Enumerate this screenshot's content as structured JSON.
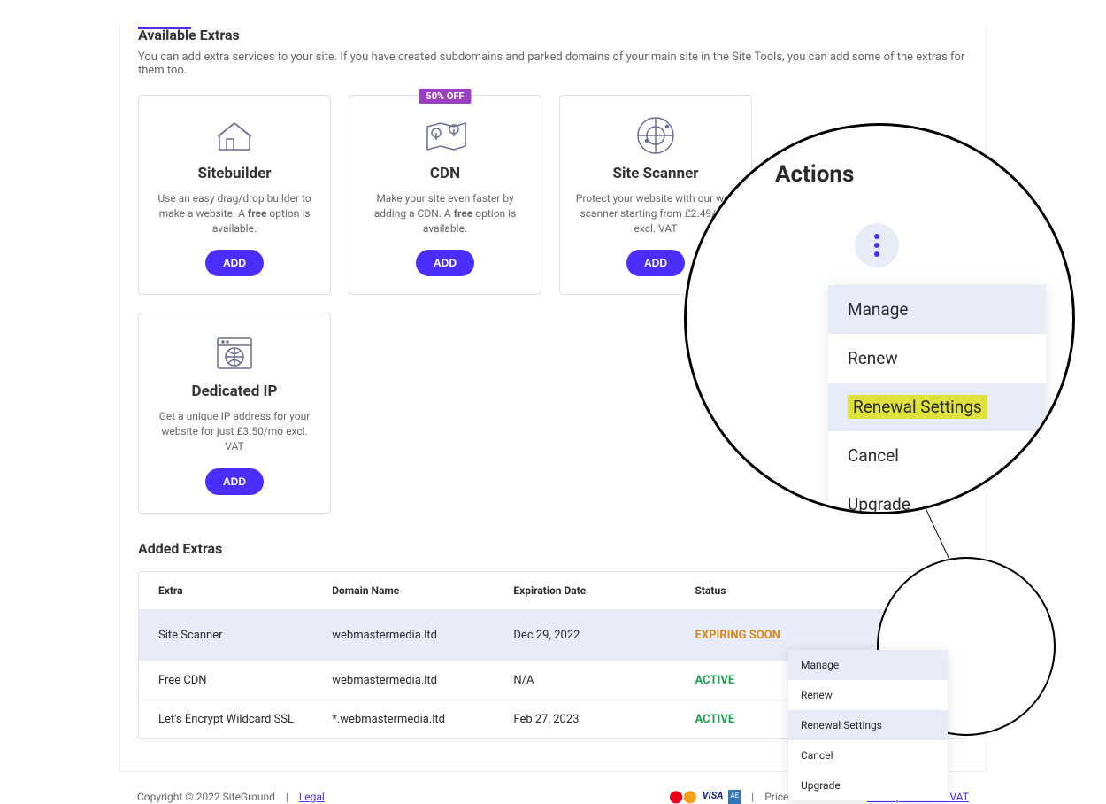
{
  "section": {
    "title": "Available Extras",
    "subtitle": "You can add extra services to your site. If you have created subdomains and parked domains of your main site in the Site Tools, you can add some of the extras for them too."
  },
  "cards": [
    {
      "title": "Sitebuilder",
      "desc_pre": "Use an easy drag/drop builder to make a website. A ",
      "desc_bold": "free",
      "desc_post": " option is available.",
      "btn": "ADD",
      "badge": ""
    },
    {
      "title": "CDN",
      "desc_pre": "Make your site even faster by adding a CDN. A ",
      "desc_bold": "free",
      "desc_post": " option is available.",
      "btn": "ADD",
      "badge": "50% OFF"
    },
    {
      "title": "Site Scanner",
      "desc_pre": "Protect your website with our web scanner starting from £2.49/mo excl. VAT",
      "desc_bold": "",
      "desc_post": "",
      "btn": "ADD",
      "badge": ""
    },
    {
      "title": "Dedicated IP",
      "desc_pre": "Get a unique IP address for your website for just £3.50/mo excl. VAT",
      "desc_bold": "",
      "desc_post": "",
      "btn": "ADD",
      "badge": ""
    }
  ],
  "added": {
    "title": "Added Extras",
    "headers": {
      "extra": "Extra",
      "domain": "Domain Name",
      "exp": "Expiration Date",
      "status": "Status",
      "actions": "Actions"
    },
    "rows": [
      {
        "extra": "Site Scanner",
        "domain": "webmastermedia.ltd",
        "exp": "Dec 29, 2022",
        "status": "EXPIRING SOON",
        "status_class": "orange"
      },
      {
        "extra": "Free CDN",
        "domain": "webmastermedia.ltd",
        "exp": "N/A",
        "status": "ACTIVE",
        "status_class": "green"
      },
      {
        "extra": "Let's Encrypt Wildcard SSL",
        "domain": "*.webmastermedia.ltd",
        "exp": "Feb 27, 2023",
        "status": "ACTIVE",
        "status_class": "green"
      }
    ]
  },
  "dropdown": {
    "items": [
      "Manage",
      "Renew",
      "Renewal Settings",
      "Cancel",
      "Upgrade"
    ],
    "highlight_idx": 2
  },
  "zoom": {
    "title": "Actions",
    "items": [
      "Manage",
      "Renew",
      "Renewal Settings",
      "Cancel",
      "Upgrade"
    ]
  },
  "footer": {
    "copyright": "Copyright © 2022 SiteGround",
    "legal": "Legal",
    "pipe": "|",
    "vat_text": "Prices exclude VAT.",
    "vat_link": "Show prices with VAT"
  }
}
